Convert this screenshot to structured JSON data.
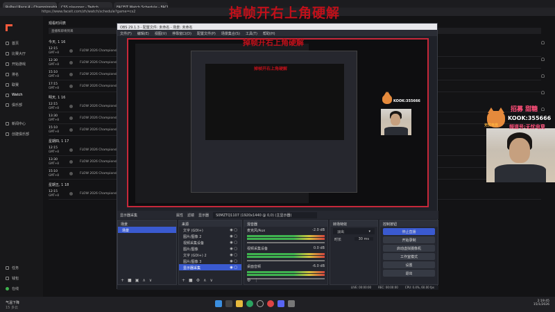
{
  "overlay_title": "掉帧开右上角硬解",
  "browser": {
    "tabs": [
      "RuPaul Race 4 - Championship - Ch",
      "CSS playoper - Twitch",
      "FACEIT Watch Schedule - FACEIT"
    ],
    "address": "https://www.faceit.com/zh/watch/schedule?game=cs2"
  },
  "sidebar": {
    "items": [
      "首页",
      "比赛大厅",
      "开始游戏",
      "排名",
      "联赛",
      "Watch",
      "俱乐部",
      "新闻中心",
      "创建俱乐部"
    ],
    "bottom": [
      "任务",
      "钱包",
      "在线"
    ]
  },
  "schedule": {
    "header": "观看时间表",
    "filter": "直播和即将到来",
    "days": [
      {
        "label": "今天, 1 16",
        "rows": [
          {
            "time": "12:15",
            "status": "GMT+8",
            "event": "FLOW 2026 Championship"
          },
          {
            "time": "12:30",
            "status": "GMT+8",
            "event": "FLOW 2026 Championship"
          },
          {
            "time": "15:10",
            "status": "GMT+8",
            "event": "FLOW 2026 Championship"
          },
          {
            "time": "17:15",
            "status": "GMT+8",
            "event": "FLOW 2026 Championship"
          }
        ]
      },
      {
        "label": "明天, 1 16",
        "rows": [
          {
            "time": "12:15",
            "status": "GMT+8",
            "event": "FLOW 2026 Championship"
          },
          {
            "time": "13:30",
            "status": "GMT+8",
            "event": "FLOW 2026 Championship"
          },
          {
            "time": "15:10",
            "status": "GMT+8",
            "event": "FLOW 2026 Championship"
          }
        ]
      },
      {
        "label": "星期四, 1 17",
        "rows": [
          {
            "time": "12:15",
            "status": "GMT+8",
            "event": "FLOW 2026 Championship"
          },
          {
            "time": "13:30",
            "status": "GMT+8",
            "event": "FLOW 2026 Championship"
          },
          {
            "time": "15:10",
            "status": "GMT+8",
            "event": "FLOW 2026 Championship"
          }
        ]
      },
      {
        "label": "星期五, 1 18",
        "rows": [
          {
            "time": "12:15",
            "status": "GMT+8",
            "event": "FLOW 2026 Championship"
          }
        ]
      }
    ]
  },
  "obs": {
    "title": "OBS 29.1.3 - 配置文件: 未命名 - 场景: 未命名",
    "menu": [
      "文件(F)",
      "编辑(E)",
      "视图(V)",
      "停靠窗口(D)",
      "配置文件(P)",
      "场景集合(S)",
      "工具(T)",
      "帮助(H)"
    ],
    "preview_bar": {
      "source": "显示器采集",
      "props": "属性",
      "filters": "滤镜",
      "display_label": "显示器",
      "display_value": "S0MZTQ1107 (1920x1440 @ 0,0) (主显示器)"
    },
    "scenes": {
      "title": "场景",
      "items": [
        "场景"
      ]
    },
    "sources": {
      "title": "来源",
      "items": [
        "文字 (GDI+)",
        "图片/图像 2",
        "视频采集设备",
        "图片/图像",
        "文字 (GDI+) 2",
        "图片/图像 3",
        "显示器采集"
      ]
    },
    "mixer": {
      "title": "混音器",
      "channels": [
        {
          "name": "麦克风/Aux",
          "db": "-2.0 dB"
        },
        {
          "name": "视频采集设备",
          "db": "0.0 dB"
        },
        {
          "name": "桌面音频",
          "db": "-6.0 dB"
        }
      ]
    },
    "transitions": {
      "title": "转场特效",
      "type": "淡出",
      "duration_label": "时长",
      "duration": "30 ms"
    },
    "controls": {
      "title": "控制按钮",
      "buttons": [
        "停止直播",
        "开始录制",
        "启动虚拟摄像机",
        "工作室模式",
        "设置",
        "退出"
      ]
    },
    "status": {
      "live": "LIVE: 00:00:00",
      "rec": "REC: 00:00:00",
      "cpu": "CPU: 0.4%, 60.00 fps"
    }
  },
  "stickers": {
    "line1": "招募 甜糖",
    "line2": "KOOK:355666",
    "line3": "频道号:无忧电竞",
    "cat_text": "无忧电竞"
  },
  "taskbar": {
    "weather": "气温下降",
    "weather_sub": "15 多云",
    "time": "2:19:45",
    "date": "15/1/2026"
  }
}
